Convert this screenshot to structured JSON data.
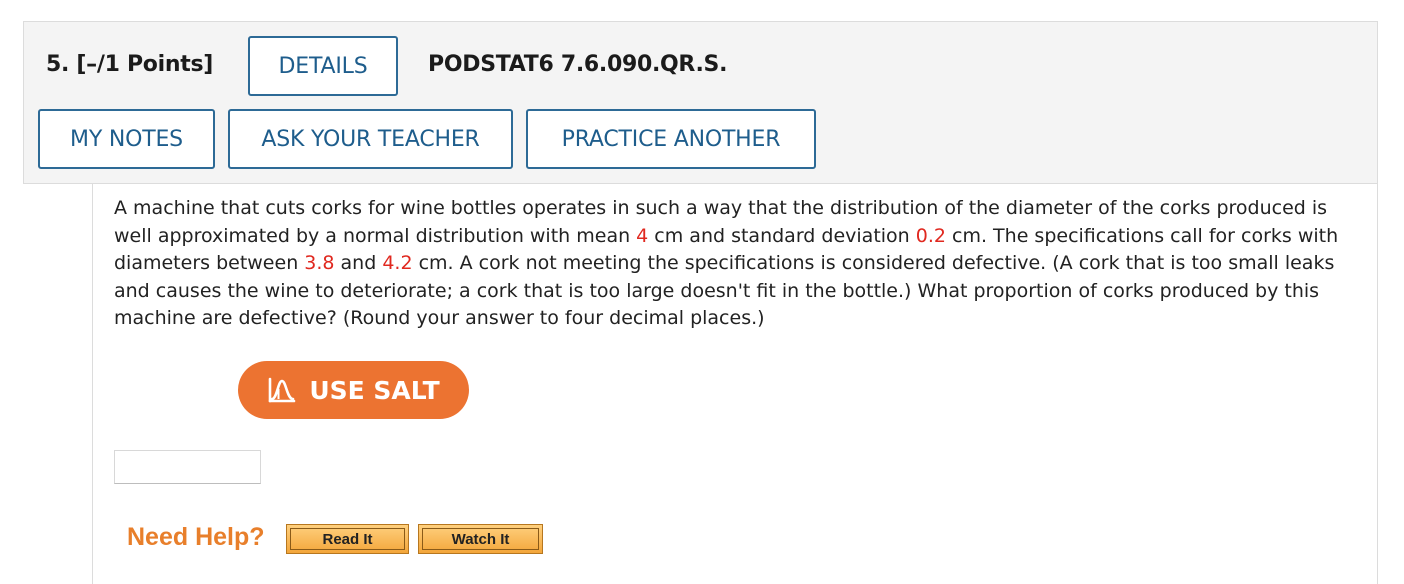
{
  "question": {
    "points": "5.  [–/1 Points]",
    "details_label": "DETAILS",
    "code": "PODSTAT6 7.6.090.QR.S.",
    "my_notes_label": "MY NOTES",
    "ask_teacher_label": "ASK YOUR TEACHER",
    "practice_another_label": "PRACTICE ANOTHER",
    "text": {
      "t1": "A machine that cuts corks for wine bottles operates in such a way that the distribution of the diameter of the corks produced is well approximated by a normal distribution with mean ",
      "mean": "4",
      "t2": " cm and standard deviation ",
      "sd": "0.2",
      "t3": " cm. The specifications call for corks with diameters between ",
      "low": "3.8",
      "t4": " and ",
      "high": "4.2",
      "t5": " cm. A cork not meeting the specifications is considered defective. (A cork that is too small leaks and causes the wine to deteriorate; a cork that is too large doesn't fit in the bottle.) What proportion of corks produced by this machine are defective? (Round your answer to four decimal places.)"
    },
    "use_salt_label": "USE SALT",
    "answer_value": "",
    "need_help_label": "Need Help?",
    "read_it_label": "Read It",
    "watch_it_label": "Watch It"
  },
  "colors": {
    "accent_blue": "#1e5d8c",
    "salt_orange": "#ec7331",
    "highlight_red": "#e0281f",
    "help_orange": "#e87f2b"
  },
  "icons": {
    "salt": "bell-curve-icon"
  }
}
